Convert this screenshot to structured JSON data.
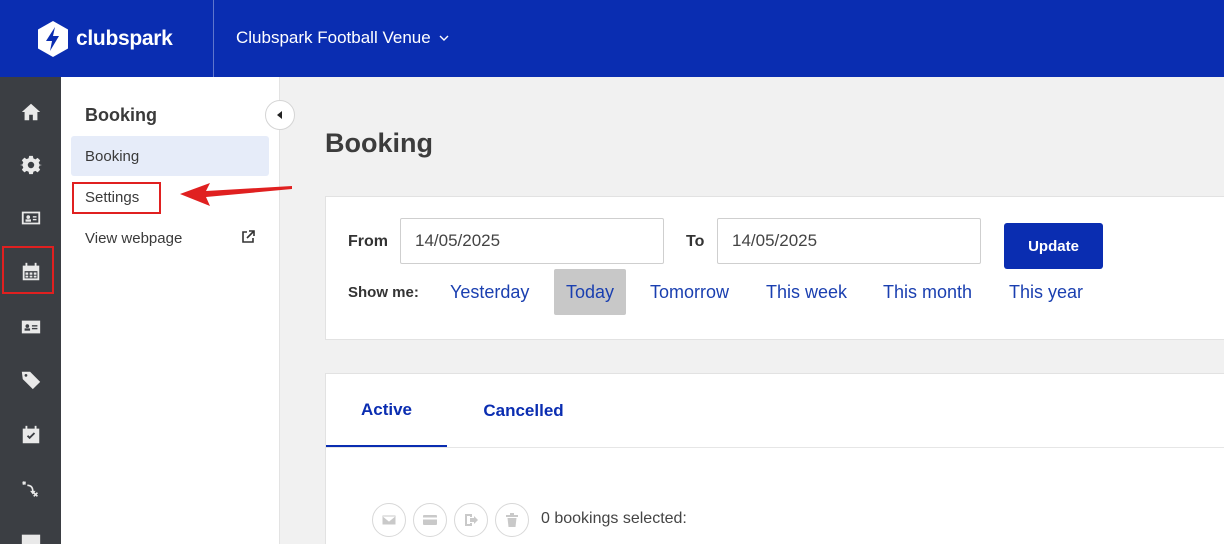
{
  "brand": {
    "name": "clubspark",
    "color": "#0a2db1"
  },
  "header": {
    "venue": "Clubspark Football Venue"
  },
  "rail": {
    "items": [
      {
        "icon": "home-icon"
      },
      {
        "icon": "gear-icon"
      },
      {
        "icon": "id-card-icon"
      },
      {
        "icon": "calendar-icon",
        "active": true
      },
      {
        "icon": "contact-card-icon"
      },
      {
        "icon": "tag-icon"
      },
      {
        "icon": "calendar-check-icon"
      },
      {
        "icon": "tactics-icon"
      },
      {
        "icon": "panel-icon"
      }
    ]
  },
  "subnav": {
    "title": "Booking",
    "items": [
      {
        "label": "Booking"
      },
      {
        "label": "Settings"
      },
      {
        "label": "View webpage"
      }
    ]
  },
  "main": {
    "title": "Booking",
    "filter": {
      "from_label": "From",
      "from_value": "14/05/2025",
      "to_label": "To",
      "to_value": "14/05/2025",
      "update_label": "Update",
      "show_me_label": "Show me:",
      "ranges": [
        "Yesterday",
        "Today",
        "Tomorrow",
        "This week",
        "This month",
        "This year"
      ],
      "active_range": "Today"
    },
    "tabs": [
      {
        "label": "Active"
      },
      {
        "label": "Cancelled"
      }
    ],
    "selected_text": "0 bookings selected:"
  },
  "colors": {
    "accent": "#0a2db1",
    "annotation": "#e02020"
  }
}
